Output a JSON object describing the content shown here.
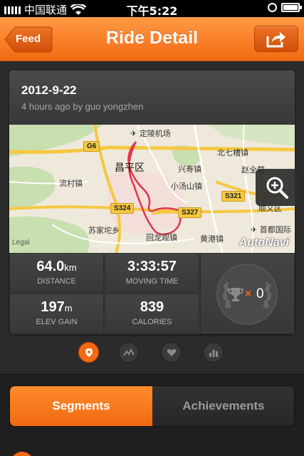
{
  "status_bar": {
    "carrier": "中国联通",
    "time": "下午5:22"
  },
  "nav": {
    "back_label": "Feed",
    "title": "Ride Detail"
  },
  "ride": {
    "date": "2012-9-22",
    "subtitle": "4 hours ago by guo yongzhen"
  },
  "map": {
    "labels": {
      "airport": "定陵机场",
      "district": "昌平区",
      "beiqijia": "北七槽镇",
      "zhaoquanying": "赵全营",
      "xingshou": "兴寿镇",
      "liucun": "流村镇",
      "xiaotangshan": "小汤山镇",
      "shunyi": "顺义区",
      "suijiatuo": "苏家坨乡",
      "huilongguan": "回龙观镇",
      "huanggang": "黄港镇",
      "capital_airport": "首都国际"
    },
    "roads": {
      "g6": "G6",
      "s324": "S324",
      "s327": "S327",
      "s321": "S321"
    },
    "legal": "Legal",
    "provider": "AutoNavi"
  },
  "stats": {
    "distance": {
      "value": "64.0",
      "unit": "km",
      "label": "DISTANCE"
    },
    "moving_time": {
      "value": "3:33:57",
      "label": "MOVING TIME"
    },
    "elev_gain": {
      "value": "197",
      "unit": "m",
      "label": "ELEV GAIN"
    },
    "calories": {
      "value": "839",
      "label": "CALORIES"
    },
    "achievements": {
      "multiplier": "×",
      "count": "0"
    }
  },
  "tabs": {
    "segments": "Segments",
    "achievements": "Achievements"
  },
  "colors": {
    "accent": "#f36a12",
    "dark": "#2b2b2b",
    "route": "#e0364a"
  }
}
